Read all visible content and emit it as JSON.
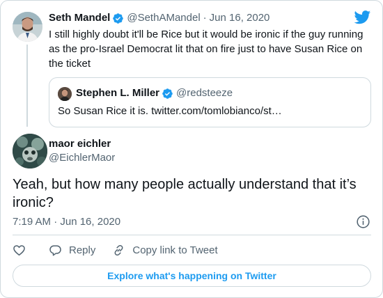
{
  "parent_tweet": {
    "name": "Seth Mandel",
    "handle": "@SethAMandel",
    "separator": "·",
    "date": "Jun 16, 2020",
    "text": "I still highly doubt it'll be Rice but it would be ironic if the guy running as the pro-Israel Democrat lit that on fire just to have Susan Rice on the ticket",
    "verified": true
  },
  "quoted_tweet": {
    "name": "Stephen L. Miller",
    "handle": "@redsteeze",
    "text": "So Susan Rice it is. twitter.com/tomlobianco/st…",
    "verified": true
  },
  "main_tweet": {
    "name": "maor eichler",
    "handle": "@EichlerMaor",
    "text": "Yeah, but how many people actually understand that it’s ironic?",
    "timestamp": "7:19 AM · Jun 16, 2020"
  },
  "actions": {
    "like_icon": "heart-icon",
    "reply_label": "Reply",
    "copy_link_label": "Copy link to Tweet"
  },
  "explore_label": "Explore what's happening on Twitter",
  "colors": {
    "accent": "#1d9bf0",
    "text": "#0f1419",
    "muted": "#536471",
    "border": "#cfd9de"
  },
  "icons": [
    "twitter-bird-icon",
    "verified-badge-icon",
    "info-icon",
    "heart-icon",
    "reply-icon",
    "link-icon"
  ]
}
